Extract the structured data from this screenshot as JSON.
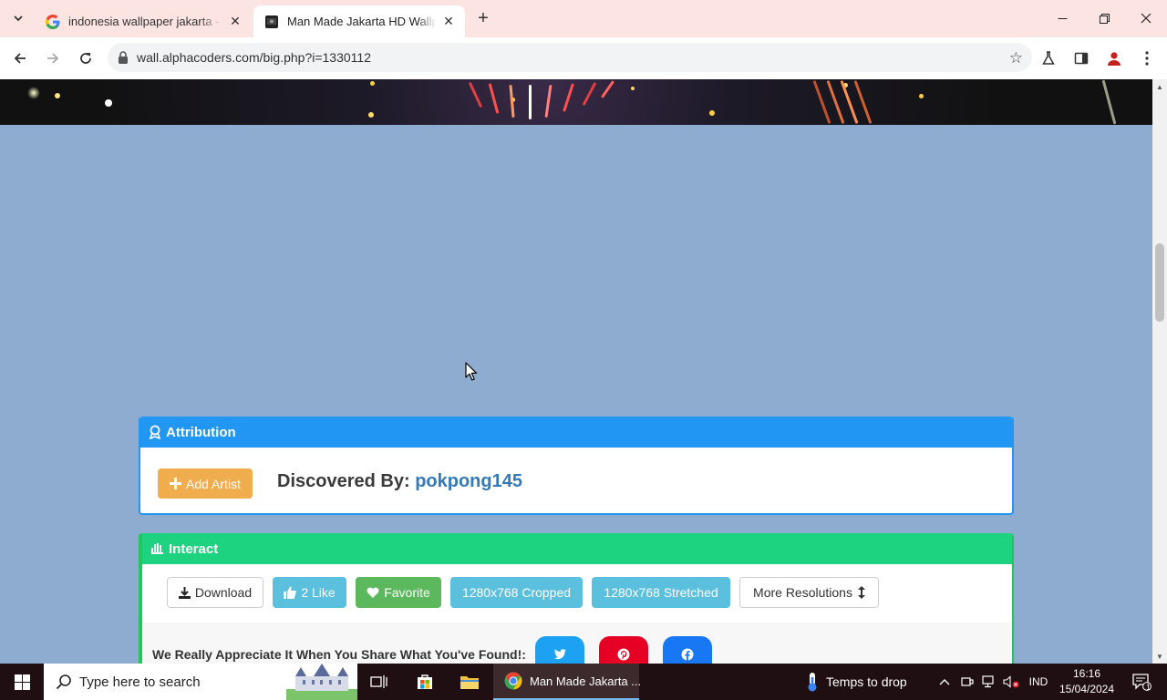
{
  "browser": {
    "tabs": [
      {
        "title": "indonesia wallpaper jakarta - G",
        "favicon": "google-icon",
        "active": false
      },
      {
        "title": "Man Made Jakarta HD Wallpaper",
        "favicon": "alphacoders-icon",
        "active": true
      }
    ],
    "url": "wall.alphacoders.com/big.php?i=1330112"
  },
  "page": {
    "attribution": {
      "header": "Attribution",
      "add_artist": "Add Artist",
      "discovered_label": "Discovered By:",
      "artist": "pokpong145"
    },
    "interact": {
      "header": "Interact",
      "buttons": {
        "download": "Download",
        "like": "2 Like",
        "favorite": "Favorite",
        "cropped": "1280x768 Cropped",
        "stretched": "1280x768 Stretched",
        "more": "More Resolutions"
      },
      "share_text": "We Really Appreciate It When You Share What You've Found!:"
    },
    "colors": {
      "attribution": "#2196f3",
      "interact": "#1ed37f",
      "background": "#8eacd0"
    }
  },
  "taskbar": {
    "search_placeholder": "Type here to search",
    "active_window": "Man Made Jakarta ...",
    "weather": "Temps to drop",
    "language": "IND",
    "time": "16:16",
    "date": "15/04/2024",
    "notification_count": "1"
  }
}
